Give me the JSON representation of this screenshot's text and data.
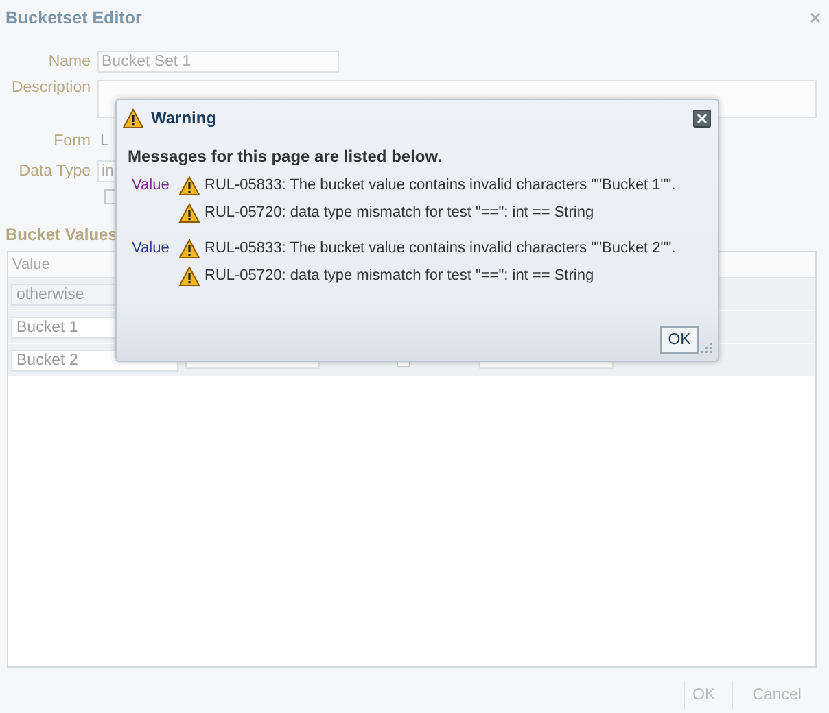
{
  "editor": {
    "title": "Bucketset Editor",
    "fields": [
      {
        "kind": "text",
        "label": "Name",
        "value": "Bucket Set 1"
      },
      {
        "kind": "textarea",
        "label": "Description"
      },
      {
        "kind": "static",
        "label": "Form",
        "value": "L"
      },
      {
        "kind": "text",
        "label": "Data Type",
        "value": "in"
      },
      {
        "kind": "checkbox",
        "checked": false
      }
    ],
    "bucket_values": {
      "title": "Bucket Values",
      "columns": [
        "Value"
      ],
      "rows": [
        {
          "value": "otherwise",
          "disabled": true,
          "cells": []
        },
        {
          "value": "Bucket 1",
          "disabled": false,
          "cells": []
        },
        {
          "value": "Bucket 2",
          "disabled": false,
          "cells": [
            {
              "kind": "field"
            },
            {
              "kind": "checkbox",
              "checked": false
            },
            {
              "kind": "field"
            }
          ]
        }
      ]
    },
    "buttons": [
      "OK",
      "Cancel"
    ]
  },
  "dialog": {
    "title": "Warning",
    "heading": "Messages for this page are listed below.",
    "groups": [
      {
        "link": "Value",
        "visited": true,
        "messages": [
          "RUL-05833: The bucket value contains invalid characters \"\"Bucket 1\"\".",
          "RUL-05720: data type mismatch for test \"==\": int == String"
        ]
      },
      {
        "link": "Value",
        "visited": false,
        "messages": [
          "RUL-05833: The bucket value contains invalid characters \"\"Bucket 2\"\".",
          "RUL-05720: data type mismatch for test \"==\": int == String"
        ]
      }
    ],
    "button": "OK"
  }
}
